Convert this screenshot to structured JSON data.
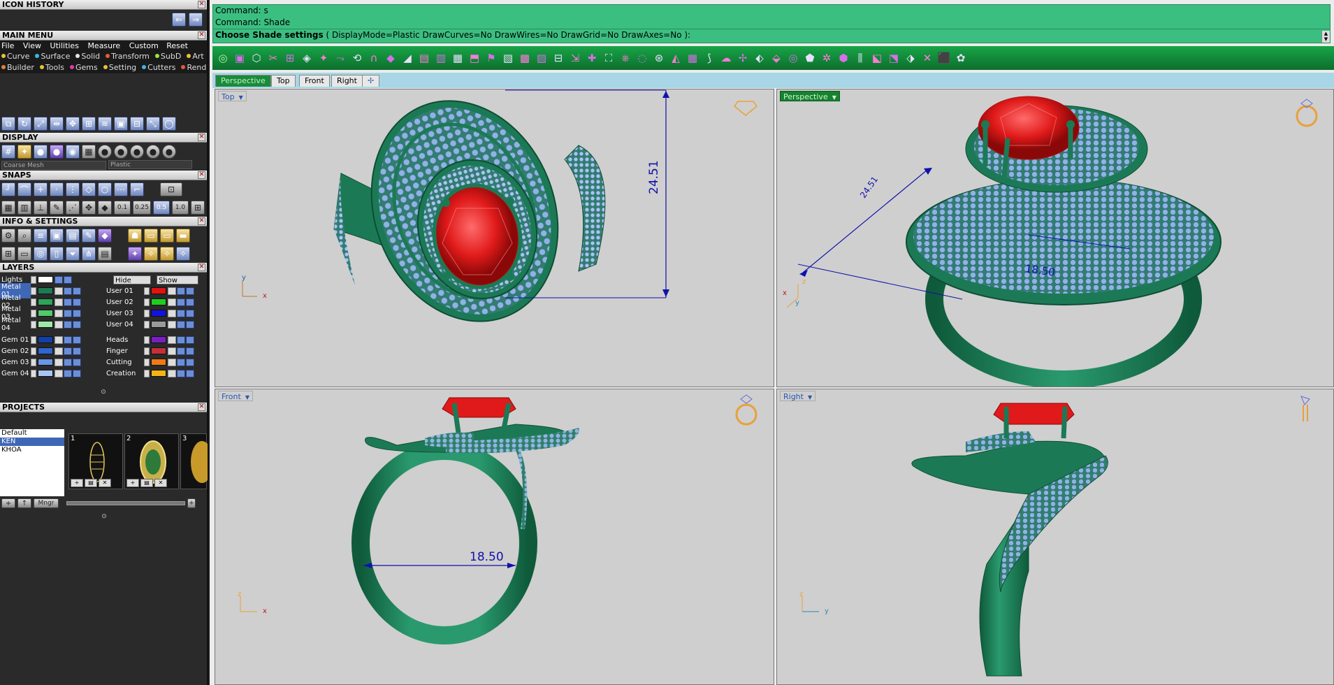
{
  "panels": {
    "icon_history": "ICON HISTORY",
    "main_menu": "MAIN MENU",
    "display": "DISPLAY",
    "snaps": "SNAPS",
    "info_settings": "INFO & SETTINGS",
    "layers": "LAYERS",
    "projects": "PROJECTS"
  },
  "menubar": [
    "File",
    "View",
    "Utilities",
    "Measure",
    "Custom"
  ],
  "reset_label": "Reset",
  "plugins_row1": [
    {
      "label": "Curve",
      "color": "#e6c13a"
    },
    {
      "label": "Surface",
      "color": "#3ab8e6"
    },
    {
      "label": "Solid",
      "color": "#e6e6e6"
    },
    {
      "label": "Transform",
      "color": "#e65a3a"
    },
    {
      "label": "SubD",
      "color": "#a0e63a"
    },
    {
      "label": "Art",
      "color": "#e6c13a"
    }
  ],
  "plugins_row2": [
    {
      "label": "Builder",
      "color": "#e6803a"
    },
    {
      "label": "Tools",
      "color": "#e6c13a"
    },
    {
      "label": "Gems",
      "color": "#e63aa0"
    },
    {
      "label": "Setting",
      "color": "#e6c13a"
    },
    {
      "label": "Cutters",
      "color": "#3ab8e6"
    },
    {
      "label": "Render",
      "color": "#e65a3a"
    }
  ],
  "display": {
    "mesh_select": "Coarse Mesh",
    "material_select": "Plastic"
  },
  "snaps": {
    "values": [
      "0.1",
      "0.25",
      "0.5",
      "1.0"
    ]
  },
  "layers": {
    "lights_label": "Lights",
    "hide_label": "Hide",
    "show_label": "Show",
    "left": [
      {
        "name": "Metal 01",
        "color": "#1d7a52",
        "active": true
      },
      {
        "name": "Metal 02",
        "color": "#2ea35a"
      },
      {
        "name": "Metal 03",
        "color": "#52c96b"
      },
      {
        "name": "Metal 04",
        "color": "#9fe8a8"
      },
      {
        "name": "Gem 01",
        "color": "#1040a8"
      },
      {
        "name": "Gem 02",
        "color": "#2f66cf"
      },
      {
        "name": "Gem 03",
        "color": "#6996e8"
      },
      {
        "name": "Gem 04",
        "color": "#a8c4f2"
      }
    ],
    "right": [
      {
        "name": "User 01",
        "color": "#e01212"
      },
      {
        "name": "User 02",
        "color": "#1ecf1e"
      },
      {
        "name": "User 03",
        "color": "#1212e0"
      },
      {
        "name": "User 04",
        "color": "#9a9a9a"
      },
      {
        "name": "Heads",
        "color": "#7a1ec4"
      },
      {
        "name": "Finger",
        "color": "#c4303a"
      },
      {
        "name": "Cutting",
        "color": "#f07a12"
      },
      {
        "name": "Creation",
        "color": "#f5b412"
      }
    ]
  },
  "projects": {
    "list": [
      "Default",
      "KEN",
      "KHOA"
    ],
    "active": "KEN",
    "thumbs": [
      "1",
      "2",
      "3"
    ],
    "mngr_label": "Mngr"
  },
  "command": {
    "line1": "Command: s",
    "line2": "Command: Shade",
    "prompt_bold": "Choose Shade settings",
    "prompt_rest": " ( DisplayMode=Plastic  DrawCurves=No  DrawWires=No  DrawGrid=No  DrawAxes=No ):"
  },
  "tabs": [
    "Perspective",
    "Top",
    "Front",
    "Right"
  ],
  "active_tab": "Perspective",
  "viewports": {
    "top": {
      "label": "Top",
      "dimension": "24.51"
    },
    "perspective": {
      "label": "Perspective",
      "dimension_a": "24.51",
      "dimension_b": "18.50"
    },
    "front": {
      "label": "Front",
      "dimension": "18.50"
    },
    "right": {
      "label": "Right"
    }
  },
  "colors": {
    "metal": "#1b7a55",
    "gem": "#e01a1a",
    "pave": "#7fa6d9",
    "dimension": "#1111aa",
    "command_bg": "#3bbf81"
  }
}
